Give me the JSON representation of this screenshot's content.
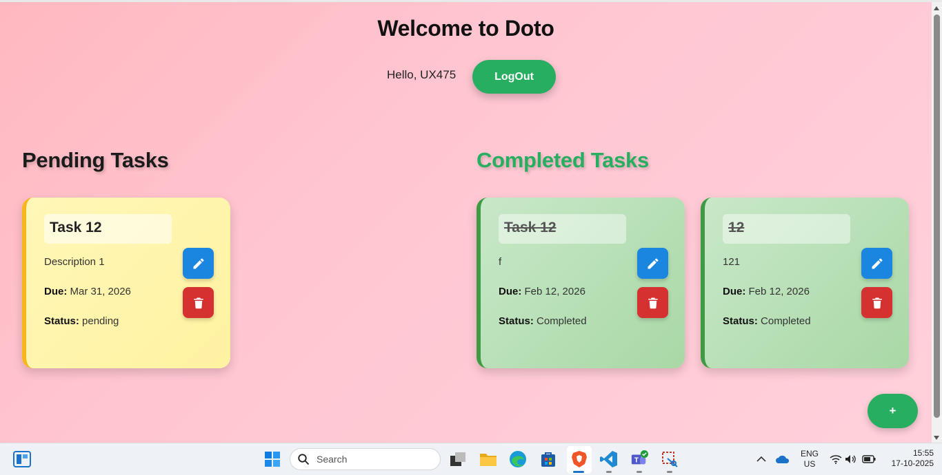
{
  "header": {
    "title": "Welcome to Doto",
    "greeting": "Hello, UX475",
    "logout_label": "LogOut"
  },
  "sections": {
    "pending_title": "Pending Tasks",
    "completed_title": "Completed Tasks"
  },
  "labels": {
    "due": "Due:",
    "status": "Status:"
  },
  "pending_tasks": [
    {
      "title": "Task 12",
      "description": "Description 1",
      "due": "Mar 31, 2026",
      "status": "pending"
    }
  ],
  "completed_tasks": [
    {
      "title": "Task 12",
      "description": "f",
      "due": "Feb 12, 2026",
      "status": "Completed"
    },
    {
      "title": "12",
      "description": "121",
      "due": "Feb 12, 2026",
      "status": "Completed"
    }
  ],
  "fab_label": "+",
  "colors": {
    "accent_green": "#27ae60",
    "edit_blue": "#1b86e0",
    "delete_red": "#d63131",
    "pending_card": "#fff4a8",
    "completed_card": "#b8e0b6"
  },
  "taskbar": {
    "search_placeholder": "Search",
    "language": "ENG",
    "region": "US",
    "time": "15:55",
    "date": "17-10-2025",
    "icons": [
      "widgets-icon",
      "windows-start-icon",
      "search-icon",
      "task-view-icon",
      "file-explorer-icon",
      "edge-icon",
      "store-icon",
      "brave-icon",
      "vscode-icon",
      "teams-icon",
      "snipping-tool-icon",
      "chevron-up-icon",
      "onedrive-icon",
      "wifi-icon",
      "volume-icon",
      "battery-icon"
    ]
  }
}
